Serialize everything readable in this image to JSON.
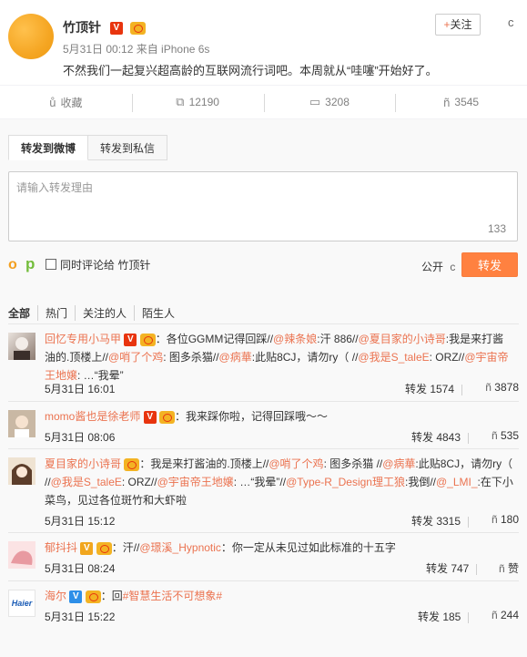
{
  "post": {
    "author": "竹顶针",
    "meta": "5月31日 00:12 来自 iPhone 6s",
    "text": "不然我们一起复兴超高龄的互联网流行词吧。本周就从“哇噻”开始好了。",
    "follow_label": "+关注",
    "follow_plus": "+",
    "follow_text": "关注",
    "menu_glyph": "c"
  },
  "actions": [
    {
      "icon": "ů",
      "label": "收藏"
    },
    {
      "icon": "⧉",
      "label": "12190"
    },
    {
      "icon": "▭",
      "label": "3208"
    },
    {
      "icon": "ñ",
      "label": "3545"
    }
  ],
  "repost": {
    "tab_weibo": "转发到微博",
    "tab_private": "转发到私信",
    "placeholder": "请输入转发理由",
    "counter": "133",
    "emoji_glyph": "o",
    "pic_glyph": "p",
    "comment_also": "同时评论给 竹顶针",
    "visibility": "公开",
    "visibility_glyph": "c",
    "send_label": "转发"
  },
  "filters": [
    "全部",
    "热门",
    "关注的人",
    "陌生人"
  ],
  "reposts": [
    {
      "user": "回忆专用小马甲",
      "badge": "V",
      "text_parts": [
        "：各位GGMM记得回踩//",
        "@辣条娘",
        ":汗 886//",
        "@夏目家的小诗哥",
        ":我是来打酱油的.顶楼上//",
        "@哨了个鸡",
        ": 图多杀猫//",
        "@病華",
        ":此贴8CJ，请勿ry（ //",
        "@我是S_taleE",
        ": ORZ//",
        "@宇宙帝王地嬢",
        ": …“我晕”"
      ],
      "time": "5月31日 16:01",
      "reposts": "转发 1574",
      "like_icon": "ñ",
      "likes": "3878"
    },
    {
      "user": "momo酱也是徐老师",
      "badge": "V",
      "text_parts": [
        "：我来踩你啦，记得回踩哦～～"
      ],
      "time": "5月31日 08:06",
      "reposts": "转发 4843",
      "like_icon": "ñ",
      "likes": "535"
    },
    {
      "user": "夏目家的小诗哥",
      "badge": "",
      "text_parts": [
        "：我是来打酱油的.顶楼上//",
        "@哨了个鸡",
        ": 图多杀猫 //",
        "@病華",
        ":此贴8CJ，请勿ry（ //",
        "@我是S_taleE",
        ": ORZ//",
        "@宇宙帝王地嬢",
        ": …“我晕”//",
        "@Type-R_Design理工狼",
        ":我倒//",
        "@_LMI_",
        ":在下小菜鸟，见过各位斑竹和大虾啦"
      ],
      "time": "5月31日 15:12",
      "reposts": "转发 3315",
      "like_icon": "ñ",
      "likes": "180"
    },
    {
      "user": "郁抖抖",
      "badge": "V",
      "text_parts": [
        "：汗//",
        "@璟溪_Hypnotic",
        "：你一定从未见过如此标准的十五字"
      ],
      "time": "5月31日 08:24",
      "reposts": "转发 747",
      "like_icon": "ñ",
      "likes": "赞"
    },
    {
      "user": "海尔",
      "badge": "V",
      "text_parts": [
        "：回",
        "#智慧生活不可想象#",
        ""
      ],
      "time": "5月31日 15:22",
      "reposts": "转发 185",
      "like_icon": "ñ",
      "likes": "244",
      "avatar_text": "Haier"
    }
  ],
  "colors": {
    "accent": "#eb7350",
    "send": "#ff8140",
    "vbadge_red": "#e8340e",
    "vbadge_blue": "#2e8fe8",
    "vbadge_gold": "#f1a61e"
  }
}
